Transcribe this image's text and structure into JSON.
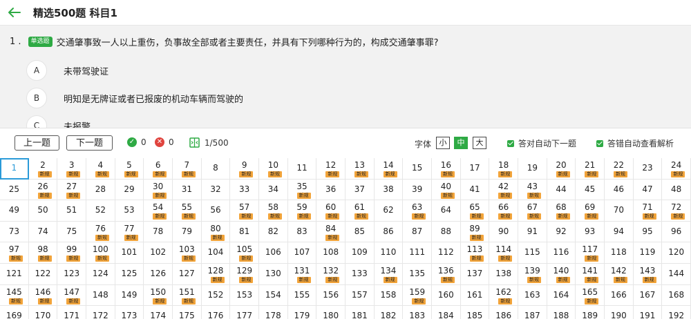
{
  "header": {
    "title": "精选500题  科目1"
  },
  "question": {
    "number": "1 .",
    "type_badge": "单选题",
    "text": "交通肇事致一人以上重伤，负事故全部或者主要责任，并具有下列哪种行为的，构成交通肇事罪?",
    "options": [
      {
        "letter": "A",
        "text": "未带驾驶证"
      },
      {
        "letter": "B",
        "text": "明知是无牌证或者已报废的机动车辆而驾驶的"
      },
      {
        "letter": "C",
        "text": "未报警"
      }
    ]
  },
  "toolbar": {
    "prev_label": "上一题",
    "next_label": "下一题",
    "correct_count": "0",
    "wrong_count": "0",
    "progress": "1/500",
    "font_label": "字体",
    "font_small": "小",
    "font_medium": "中",
    "font_large": "大",
    "auto_next_label": "答对自动下一题",
    "auto_explain_label": "答错自动查看解析"
  },
  "colors": {
    "accent": "#2eaa44",
    "new_tag": "#f2a43a",
    "current": "#2a9ad8"
  },
  "grid": {
    "new_label": "新规",
    "current": 1,
    "visible_from": 1,
    "visible_to": 192,
    "new_questions": [
      2,
      3,
      4,
      5,
      6,
      7,
      9,
      10,
      12,
      13,
      14,
      16,
      18,
      20,
      21,
      22,
      24,
      26,
      27,
      30,
      35,
      40,
      42,
      43,
      54,
      55,
      57,
      58,
      59,
      60,
      61,
      63,
      65,
      66,
      67,
      68,
      69,
      71,
      72,
      76,
      77,
      80,
      84,
      89,
      97,
      98,
      99,
      100,
      103,
      105,
      113,
      114,
      117,
      128,
      129,
      131,
      132,
      134,
      136,
      139,
      140,
      141,
      142,
      143,
      145,
      146,
      147,
      150,
      151,
      159,
      162,
      165
    ]
  }
}
